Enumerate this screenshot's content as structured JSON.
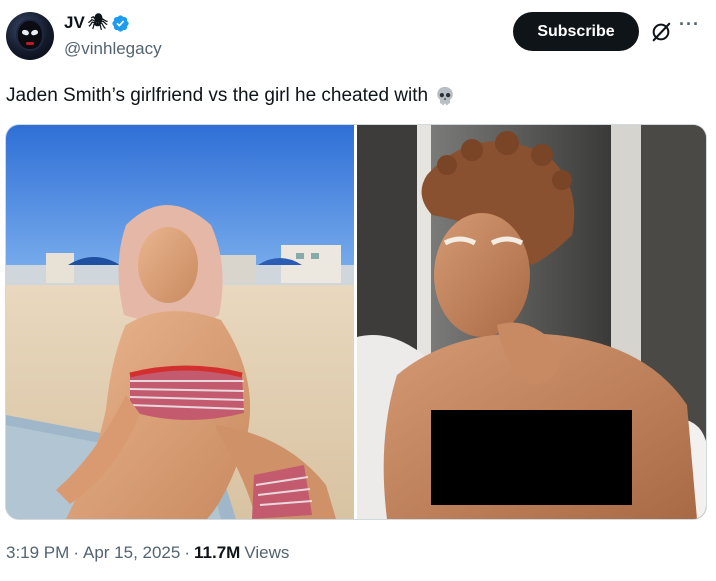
{
  "author": {
    "display_name": "JV",
    "name_emoji": "🕷",
    "handle": "@vinhlegacy",
    "verified_color": "#1d9bf0"
  },
  "actions": {
    "subscribe_label": "Subscribe",
    "grok_icon": "grok-icon",
    "more_label": "···"
  },
  "tweet": {
    "text": "Jaden Smith’s girlfriend vs the girl he cheated with",
    "emoji": "skull-emoji"
  },
  "media": {
    "images": [
      {
        "name": "beach-bikini-photo"
      },
      {
        "name": "window-selfie-photo",
        "censored": true
      }
    ]
  },
  "meta": {
    "time": "3:19 PM",
    "separator": "·",
    "date": "Apr 15, 2025",
    "views_count": "11.7M",
    "views_label": "Views"
  }
}
